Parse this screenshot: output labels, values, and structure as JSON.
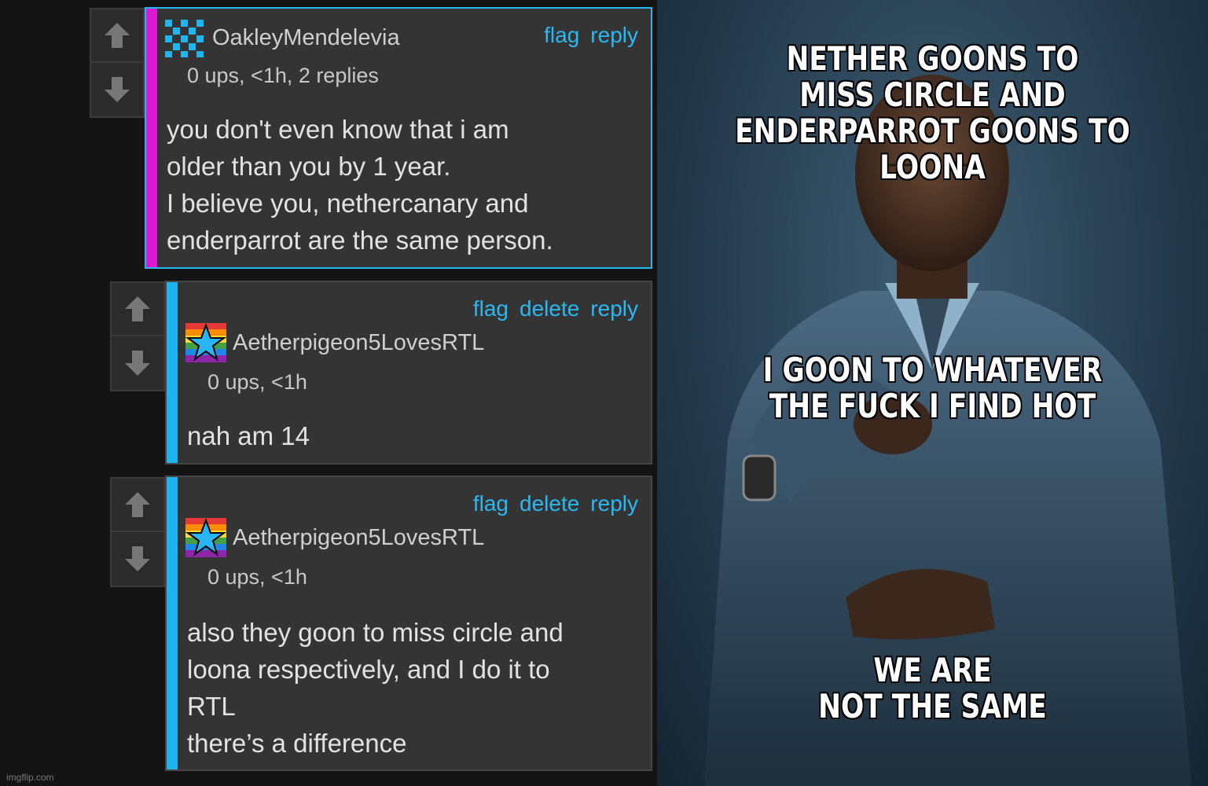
{
  "comments": [
    {
      "username": "OakleyMendelevia",
      "meta": "0 ups, <1h, 2 replies",
      "actions": [
        "flag",
        "reply"
      ],
      "body": "you don't even know that i am\nolder than you by 1 year.\nI believe you, nethercanary and\nenderparrot are the same person.",
      "stripe_color": "#d81bd1",
      "avatar_icon": "pixel-pattern-icon"
    },
    {
      "username": "Aetherpigeon5LovesRTL",
      "meta": "0 ups, <1h",
      "actions": [
        "flag",
        "delete",
        "reply"
      ],
      "body": "nah am 14",
      "stripe_color": "#1eb4ee",
      "avatar_icon": "rainbow-star-icon"
    },
    {
      "username": "Aetherpigeon5LovesRTL",
      "meta": "0 ups, <1h",
      "actions": [
        "flag",
        "delete",
        "reply"
      ],
      "body": "also they goon to miss circle and\nloona respectively, and I do it to\nRTL\nthere’s a difference",
      "stripe_color": "#1eb4ee",
      "avatar_icon": "rainbow-star-icon"
    }
  ],
  "watermark": "imgflip.com",
  "meme": {
    "top_text": "NETHER GOONS TO\nMISS CIRCLE AND\nENDERPARROT GOONS TO LOONA",
    "middle_text": "I GOON TO WHATEVER\nTHE FUCK I FIND HOT",
    "bottom_text": "WE ARE\nNOT THE SAME"
  },
  "colors": {
    "link": "#2ab8f2",
    "highlight_border": "#24b7f0",
    "card_bg": "#343434"
  }
}
